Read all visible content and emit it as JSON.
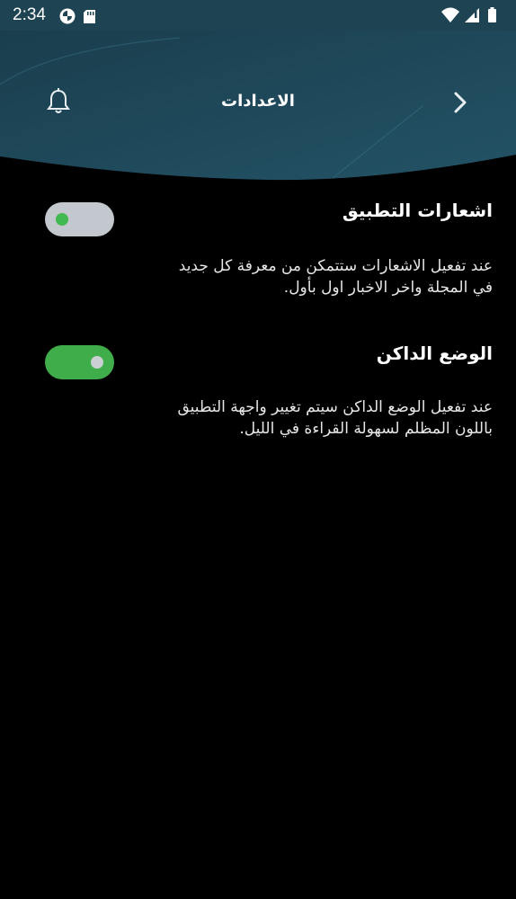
{
  "status_bar": {
    "time": "2:34"
  },
  "header": {
    "title": "الاعدادات",
    "left_icon": "bell-icon",
    "right_icon": "chevron-right-icon"
  },
  "settings": [
    {
      "title": "اشعارات التطبيق",
      "description_lines": [
        "عند تفعيل الاشعارات ستتمكن من معرفة كل جديد",
        "في المجلة واخر الاخبار اول بأول."
      ],
      "enabled": false
    },
    {
      "title": "الوضع الداكن",
      "description_lines": [
        "عند تفعيل الوضع الداكن سيتم تغيير واجهة التطبيق",
        "باللون المظلم لسهولة القراءة في الليل."
      ],
      "enabled": true
    }
  ],
  "colors": {
    "header_bg": "#1e4453",
    "toggle_on": "#3fae4a",
    "toggle_off": "#c2c8cd",
    "background": "#000000"
  }
}
